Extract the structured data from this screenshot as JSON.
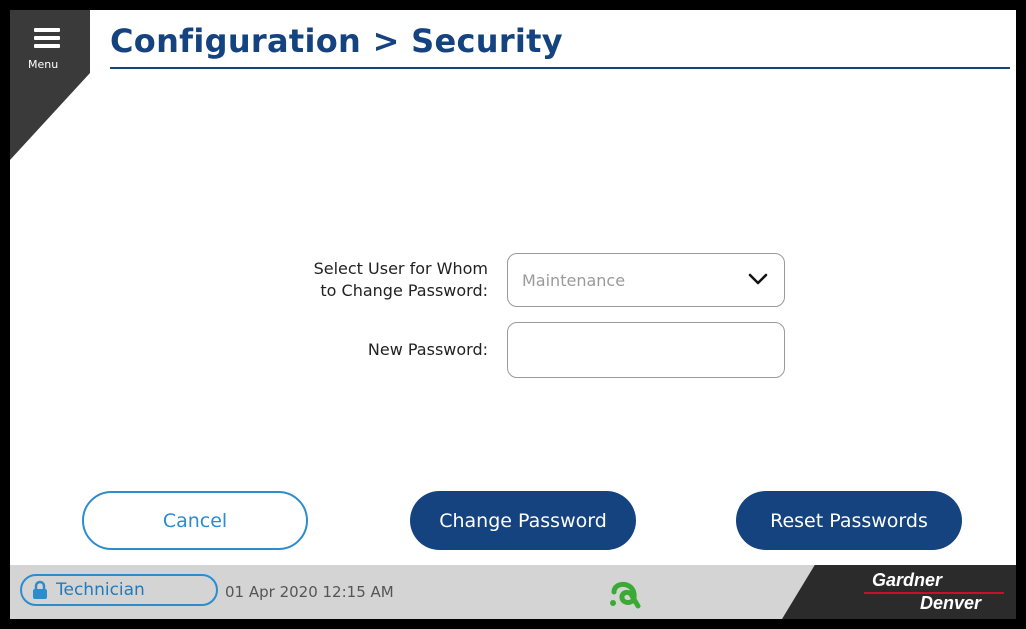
{
  "menu": {
    "label": "Menu",
    "icon": "hamburger-icon"
  },
  "header": {
    "title": "Configuration > Security"
  },
  "form": {
    "select_user_label_line1": "Select User for Whom",
    "select_user_label_line2": "to Change Password:",
    "selected_user": "Maintenance",
    "new_password_label": "New Password:",
    "new_password_value": ""
  },
  "buttons": {
    "cancel": "Cancel",
    "change_password": "Change Password",
    "reset_passwords": "Reset Passwords"
  },
  "status": {
    "user": "Technician",
    "datetime": "01 Apr 2020  12:15 AM",
    "brand_top": "Gardner",
    "brand_bottom": "Denver"
  },
  "colors": {
    "primary": "#14437f",
    "accent": "#2b8dce",
    "status_logo": "#3aaa35",
    "brand_red": "#c8102e"
  }
}
